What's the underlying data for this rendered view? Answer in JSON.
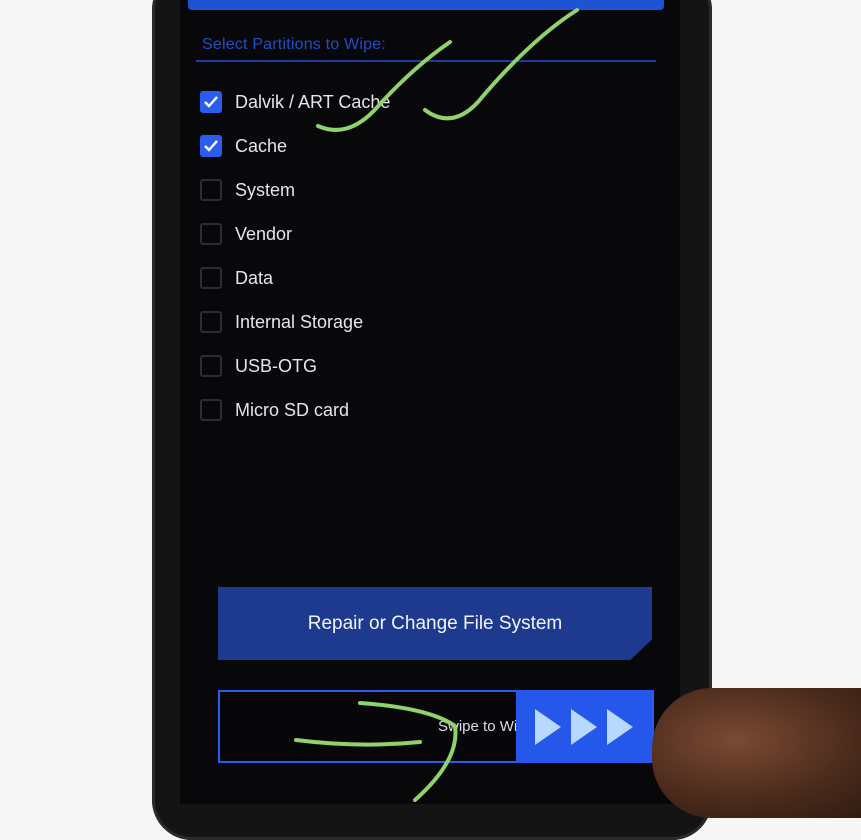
{
  "screen": {
    "section_title": "Select Partitions to Wipe:",
    "partitions": [
      {
        "label": "Dalvik / ART Cache",
        "checked": true
      },
      {
        "label": "Cache",
        "checked": true
      },
      {
        "label": "System",
        "checked": false
      },
      {
        "label": "Vendor",
        "checked": false
      },
      {
        "label": "Data",
        "checked": false
      },
      {
        "label": "Internal Storage",
        "checked": false
      },
      {
        "label": "USB-OTG",
        "checked": false
      },
      {
        "label": "Micro SD card",
        "checked": false
      }
    ],
    "repair_button_label": "Repair or Change File System",
    "swipe_label": "Swipe to Wipe"
  },
  "colors": {
    "accent": "#2b5df0",
    "background": "#08080a",
    "annotation": "#8fd36a"
  },
  "icons": [
    "checkmark-icon",
    "swipe-arrow-icon"
  ]
}
